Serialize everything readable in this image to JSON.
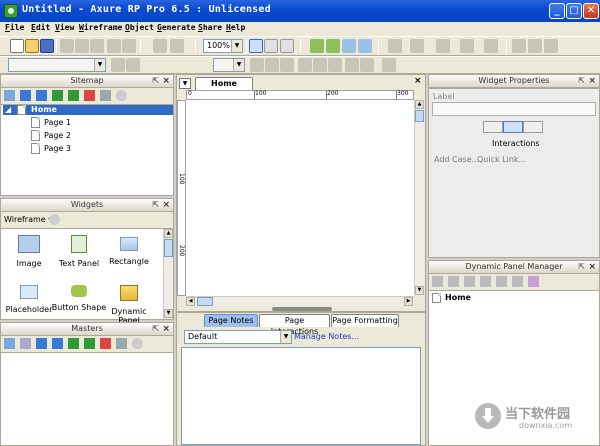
{
  "app": {
    "title": "Untitled - Axure RP Pro 6.5 : Unlicensed"
  },
  "window_controls": {
    "minimize": "_",
    "maximize": "□",
    "close": "✕"
  },
  "menu": [
    "File",
    "Edit",
    "View",
    "Wireframe",
    "Object",
    "Generate",
    "Share",
    "Help"
  ],
  "toolbar": {
    "zoom": "100%"
  },
  "sitemap": {
    "title": "Sitemap",
    "root": "Home",
    "pages": [
      "Page 1",
      "Page 2",
      "Page 3"
    ]
  },
  "widgets": {
    "title": "Widgets",
    "library": "Wireframe",
    "items": [
      "Image",
      "Text Panel",
      "Rectangle",
      "Placeholder",
      "Button Shape",
      "Dynamic Panel"
    ]
  },
  "masters": {
    "title": "Masters"
  },
  "canvas": {
    "tab": "Home",
    "ruler_labels": [
      "0",
      "100",
      "200",
      "300"
    ],
    "vruler_labels": [
      "100",
      "200"
    ]
  },
  "notes": {
    "tabs": [
      "Page Notes",
      "Page Interactions",
      "Page Formatting"
    ],
    "select": "Default",
    "manage_link": "Manage Notes..."
  },
  "widget_properties": {
    "title": "Widget Properties",
    "label_caption": "Label",
    "interactions_label": "Interactions",
    "add_case": "Add Case...",
    "quick_link": "Quick Link..."
  },
  "dynamic_panel_manager": {
    "title": "Dynamic Panel Manager",
    "item": "Home"
  },
  "watermark": {
    "cn": "当下软件园",
    "url": "downxia.com"
  }
}
